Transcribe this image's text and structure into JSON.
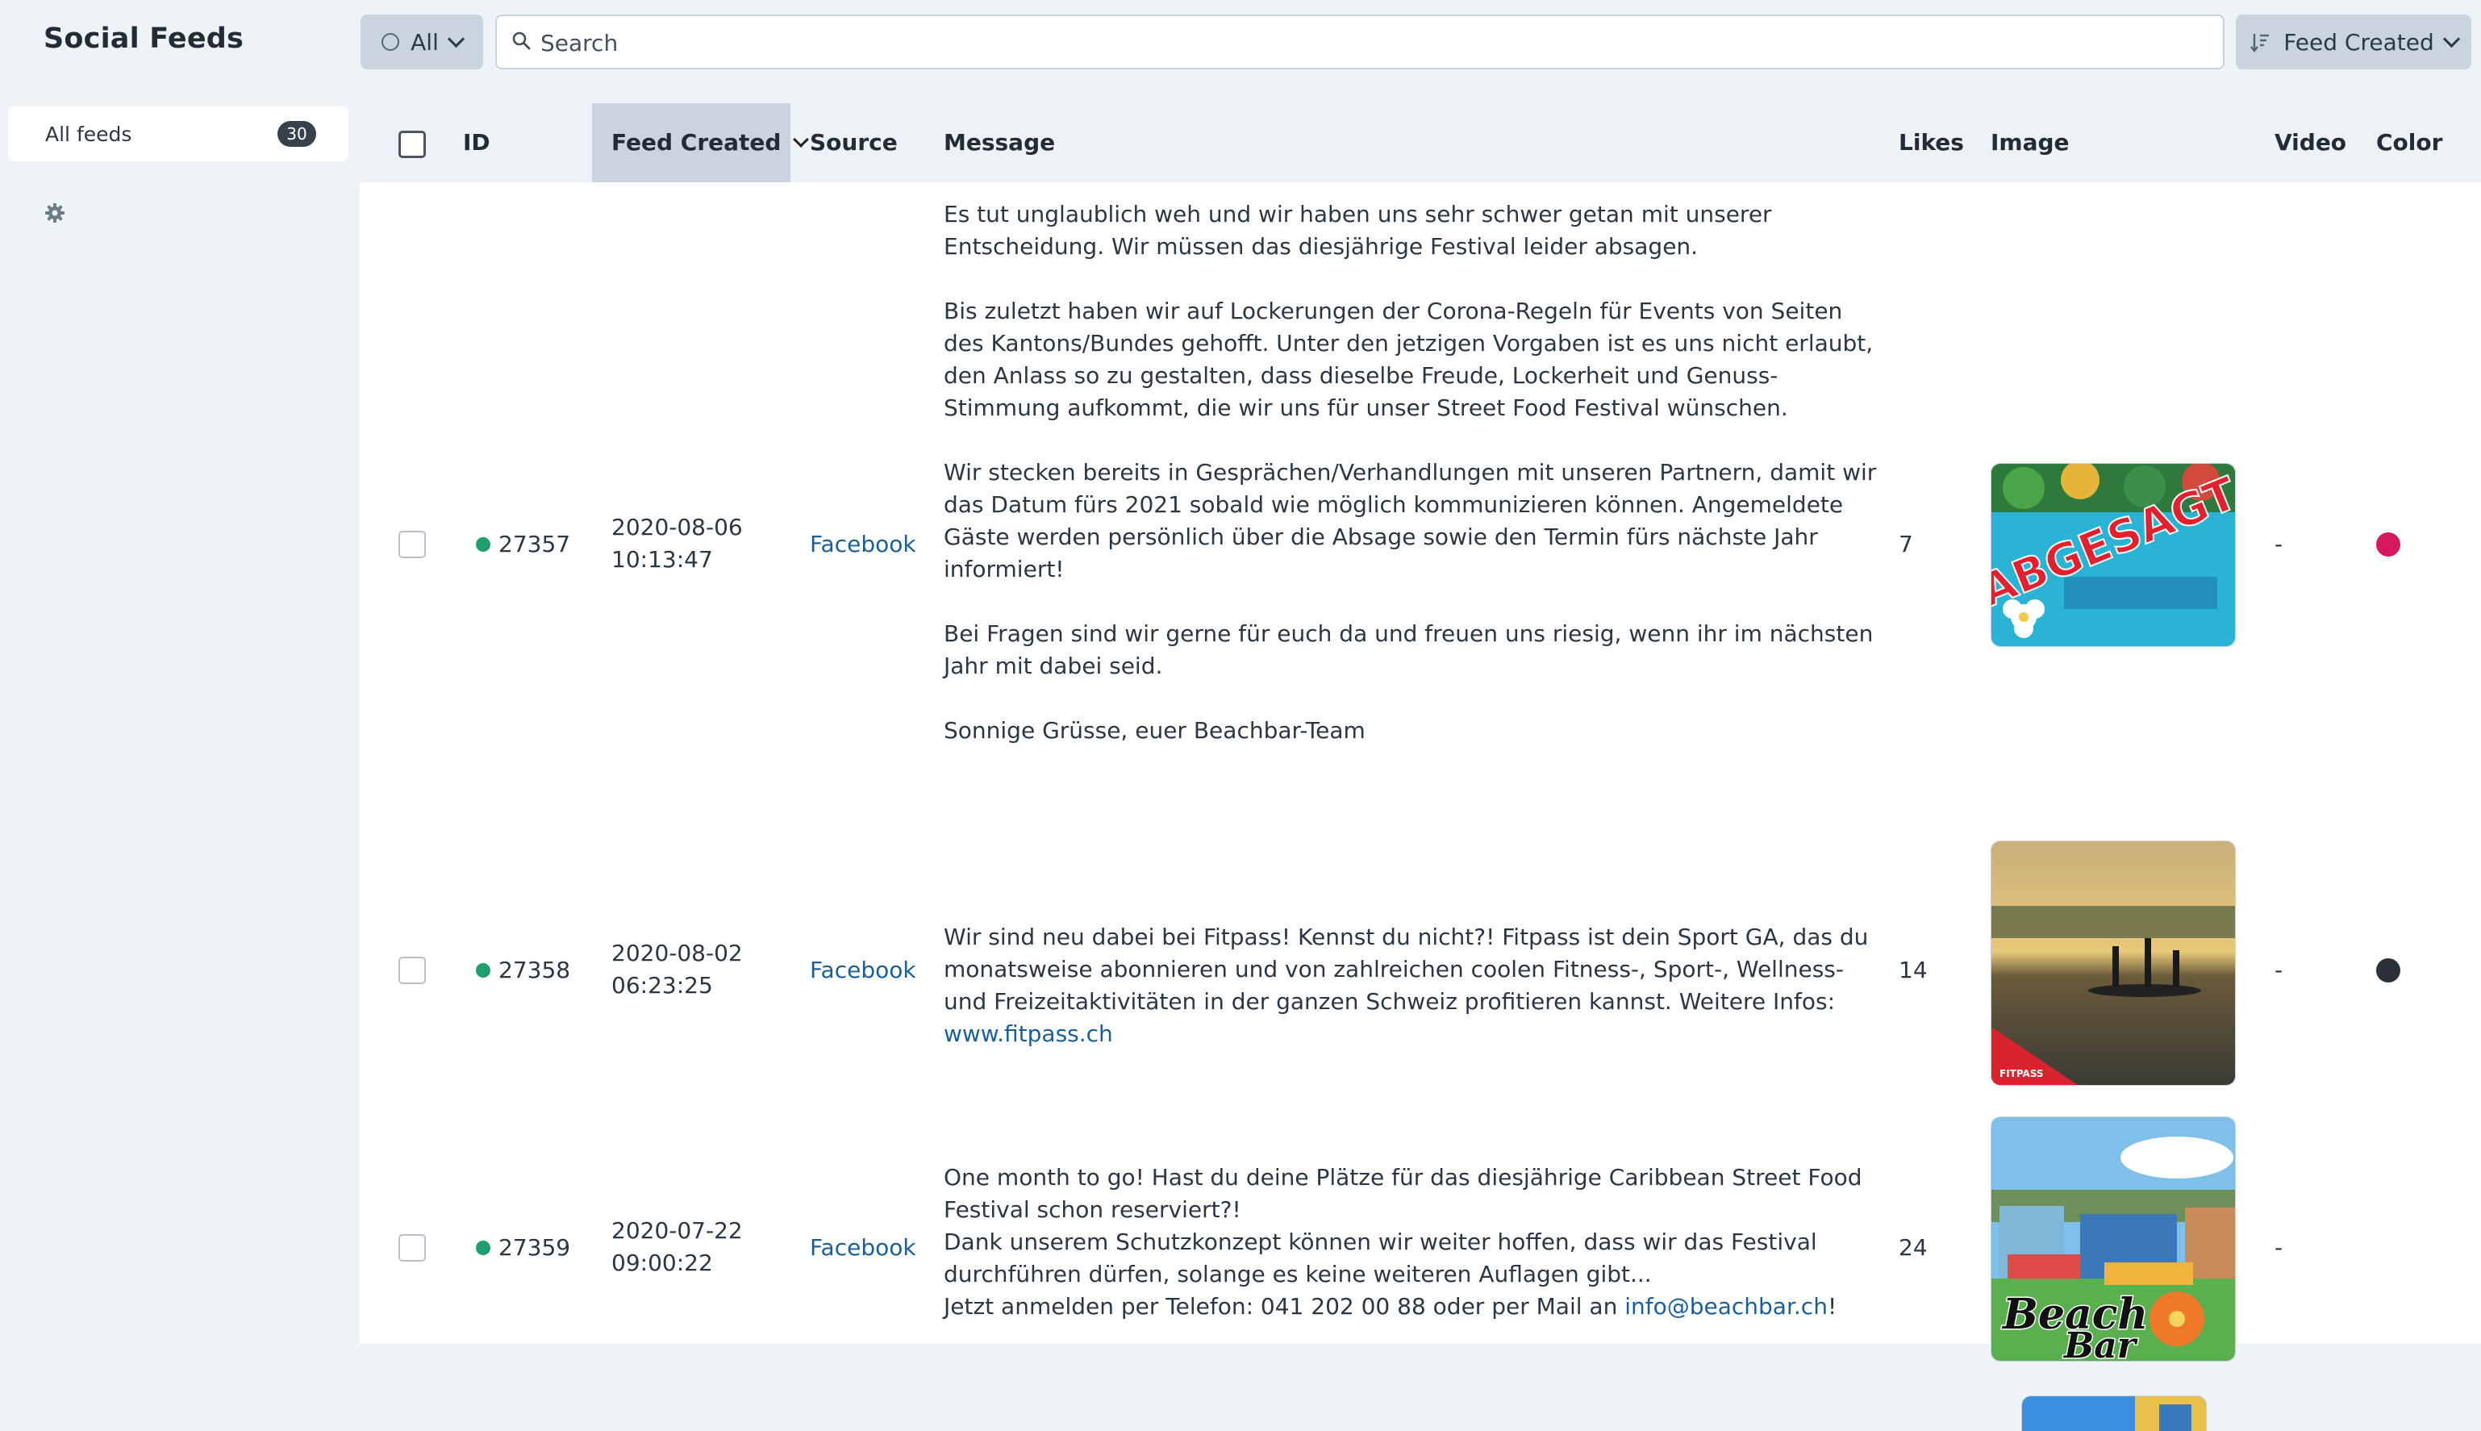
{
  "app": {
    "title": "Social Feeds"
  },
  "toolbar": {
    "filter_label": "All",
    "search_placeholder": "Search",
    "sort_label": "Feed Created"
  },
  "sidebar": {
    "items": [
      {
        "label": "All feeds",
        "count": "30"
      }
    ]
  },
  "table": {
    "headers": {
      "id": "ID",
      "created": "Feed Created",
      "source": "Source",
      "message": "Message",
      "likes": "Likes",
      "image": "Image",
      "video": "Video",
      "color": "Color"
    },
    "rows": [
      {
        "id": "27357",
        "date": "2020-08-06",
        "time": "10:13:47",
        "source": "Facebook",
        "message": [
          "Es tut unglaublich weh und wir haben uns sehr schwer getan mit unserer Entscheidung. Wir müssen das diesjährige Festival leider absagen.",
          "Bis zuletzt haben wir auf Lockerungen der Corona-Regeln für Events von Seiten des Kantons/Bundes gehofft. Unter den jetzigen Vorgaben ist es uns nicht erlaubt, den Anlass so zu gestalten, dass dieselbe Freude, Lockerheit und Genuss-Stimmung aufkommt, die wir uns für unser Street Food Festival wünschen.",
          "Wir stecken bereits in Gesprächen/Verhandlungen mit unseren Partnern, damit wir das Datum fürs 2021 sobald wie möglich kommunizieren können. Angemeldete Gäste werden persönlich über die Absage sowie den Termin fürs nächste Jahr informiert!",
          "Bei Fragen sind wir gerne für euch da und freuen uns riesig, wenn ihr im nächsten Jahr mit dabei seid.",
          "Sonnige Grüsse, euer Beachbar-Team"
        ],
        "likes": "7",
        "image_text": "ABGESAGT",
        "video": "-",
        "color": "#d6185d"
      },
      {
        "id": "27358",
        "date": "2020-08-02",
        "time": "06:23:25",
        "source": "Facebook",
        "message_text": "Wir sind neu dabei bei Fitpass! Kennst du nicht?! Fitpass ist dein Sport GA, das du monatsweise abonnieren und von zahlreichen coolen Fitness-, Sport-, Wellness- und Freizeitaktivitäten in der ganzen Schweiz profitieren kannst. Weitere Infos: ",
        "message_link": "www.fitpass.ch",
        "likes": "14",
        "image_text": "FITPASS",
        "video": "-",
        "color": "#2b3138"
      },
      {
        "id": "27359",
        "date": "2020-07-22",
        "time": "09:00:22",
        "source": "Facebook",
        "message_lines": [
          "One month to go! Hast du deine Plätze für das diesjährige Caribbean Street Food Festival schon reserviert?!",
          "Dank unserem Schutzkonzept können wir weiter hoffen, dass wir das Festival durchführen dürfen, solange es keine weiteren Auflagen gibt..."
        ],
        "message_prefix": "Jetzt anmelden per Telefon: 041 202 00 88 oder per Mail an ",
        "message_link": "info@beachbar.ch",
        "message_suffix": "!",
        "likes": "24",
        "image_text_1": "Beach",
        "image_text_2": "Bar",
        "video": "-"
      }
    ]
  }
}
